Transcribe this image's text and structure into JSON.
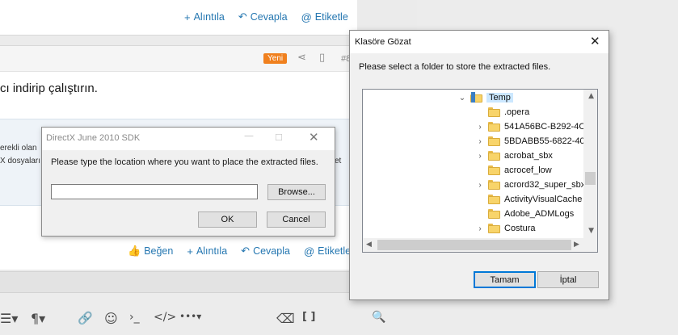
{
  "forum": {
    "top_actions": [
      {
        "icon": "plus-icon",
        "glyph": "+",
        "label": "Alıntıla"
      },
      {
        "icon": "reply-icon",
        "glyph": "↶",
        "label": "Cevapla"
      },
      {
        "icon": "at-icon",
        "glyph": "@",
        "label": "Etiketle"
      }
    ],
    "post": {
      "badge": "Yeni",
      "number": "#8",
      "body_text": "cı indirip çalıştırın.",
      "quote_line1": "erekli olan",
      "quote_line2": "X dosyaları",
      "quote_right": "et"
    },
    "bottom_actions": [
      {
        "icon": "like-icon",
        "glyph": "👍",
        "label": "Beğen"
      },
      {
        "icon": "plus-icon",
        "glyph": "+",
        "label": "Alıntıla"
      },
      {
        "icon": "reply-icon",
        "glyph": "↶",
        "label": "Cevapla"
      },
      {
        "icon": "at-icon",
        "glyph": "@",
        "label": "Etiketle"
      }
    ],
    "toolbar": {
      "list": "☰▾",
      "paragraph": "¶▾",
      "link": "🔗",
      "smiley": "☺",
      "code": "›_",
      "html": "</>",
      "more": "•••▾",
      "eraser": "⌫",
      "brackets": "[ ]",
      "preview": "🔍"
    }
  },
  "dx_dialog": {
    "title": "DirectX June 2010 SDK",
    "prompt": "Please type the location where you want to place the extracted files.",
    "path_value": "",
    "browse_label": "Browse...",
    "ok_label": "OK",
    "cancel_label": "Cancel"
  },
  "folder_dialog": {
    "title": "Klasöre Gözat",
    "prompt": "Please select a folder to store the extracted files.",
    "tree": [
      {
        "label": "Temp",
        "expanded": true,
        "selected": true
      },
      {
        "label": ".opera"
      },
      {
        "label": "541A56BC-B292-4C"
      },
      {
        "label": "5BDABB55-6822-408"
      },
      {
        "label": "acrobat_sbx"
      },
      {
        "label": "acrocef_low"
      },
      {
        "label": "acrord32_super_sbx"
      },
      {
        "label": "ActivityVisualCache"
      },
      {
        "label": "Adobe_ADMLogs"
      },
      {
        "label": "Costura"
      }
    ],
    "ok_label": "Tamam",
    "cancel_label": "İptal"
  }
}
